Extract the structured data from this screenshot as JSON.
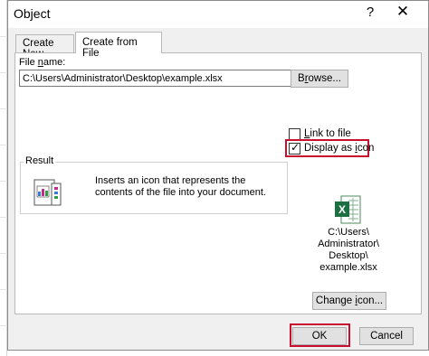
{
  "dialog": {
    "title": "Object",
    "help_glyph": "?",
    "close_glyph": "✕"
  },
  "tabs": [
    {
      "label": "Create New",
      "active": false
    },
    {
      "label": "Create from File",
      "active": true
    }
  ],
  "file": {
    "label_prefix": "File ",
    "label_underlined": "n",
    "label_suffix": "ame:",
    "value": "C:\\Users\\Administrator\\Desktop\\example.xlsx",
    "browse_prefix": "B",
    "browse_underlined": "r",
    "browse_suffix": "owse..."
  },
  "options": {
    "link_underlined": "L",
    "link_rest": "ink to file",
    "link_checked": false,
    "display_prefix": "Display as ",
    "display_underlined": "i",
    "display_suffix": "con",
    "display_checked": true,
    "tick_glyph": "✓"
  },
  "result": {
    "legend": "Result",
    "text": "Inserts an icon that represents the contents of the file into your document."
  },
  "icon_preview": {
    "icon": "excel-file-icon",
    "caption_lines": [
      "C:\\Users\\",
      "Administrator\\",
      "Desktop\\",
      "example.xlsx"
    ],
    "change_prefix": "Change ",
    "change_underlined": "i",
    "change_suffix": "con..."
  },
  "buttons": {
    "ok": "OK",
    "cancel": "Cancel"
  },
  "colors": {
    "highlight": "#c8102e",
    "excel_green": "#1d6f42"
  }
}
